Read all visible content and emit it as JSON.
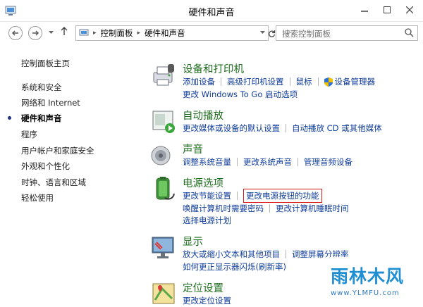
{
  "window": {
    "title": "硬件和声音"
  },
  "navbar": {
    "breadcrumb": [
      "控制面板",
      "硬件和声音"
    ],
    "search_placeholder": "搜索控制面板"
  },
  "leftnav": {
    "items": [
      {
        "label": "控制面板主页"
      },
      {
        "label": "系统和安全"
      },
      {
        "label": "网络和 Internet"
      },
      {
        "label": "硬件和声音",
        "active": true
      },
      {
        "label": "程序"
      },
      {
        "label": "用户帐户和家庭安全"
      },
      {
        "label": "外观和个性化"
      },
      {
        "label": "时钟、语言和区域"
      },
      {
        "label": "轻松使用"
      }
    ]
  },
  "sections": {
    "devices": {
      "title": "设备和打印机",
      "links": [
        "添加设备",
        "高级打印机设置",
        "鼠标",
        "设备管理器",
        "更改 Windows To Go 启动选项"
      ]
    },
    "autoplay": {
      "title": "自动播放",
      "links": [
        "更改媒体或设备的默认设置",
        "自动播放 CD 或其他媒体"
      ]
    },
    "sound": {
      "title": "声音",
      "links": [
        "调整系统音量",
        "更改系统声音",
        "管理音频设备"
      ]
    },
    "power": {
      "title": "电源选项",
      "links": [
        "更改节能设置",
        "更改电源按钮的功能",
        "唤醒计算机时需要密码",
        "更改计算机睡眠时间",
        "选择电源计划"
      ]
    },
    "display": {
      "title": "显示",
      "links": [
        "放大或缩小文本和其他项目",
        "调整屏幕分辨率",
        "如何更正显示器闪烁(刷新率)"
      ]
    },
    "location": {
      "title": "定位设置",
      "links": [
        "更改定位设置"
      ]
    }
  },
  "watermark": {
    "brand": "雨林木风",
    "url": "www.YLMFU.com"
  },
  "colors": {
    "heading": "#1e6d1e",
    "link": "#0f3c9b",
    "highlight": "#d7191c"
  }
}
